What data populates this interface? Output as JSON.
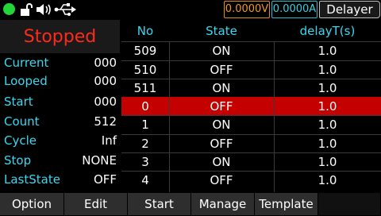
{
  "status_bar": {
    "icons": [
      "power-dot-icon",
      "lock-open-icon",
      "speaker-icon",
      "usb-icon"
    ],
    "voltage": "0.0000V",
    "current": "0.0000A",
    "mode": "Delayer"
  },
  "left_panel": {
    "state": "Stopped",
    "rows": [
      {
        "label": "Current",
        "value": "000"
      },
      {
        "label": "Looped",
        "value": "000"
      },
      {
        "label": "Start",
        "value": "000"
      },
      {
        "label": "Count",
        "value": "512"
      },
      {
        "label": "Cycle",
        "value": "Inf"
      },
      {
        "label": "Stop",
        "value": "NONE"
      },
      {
        "label": "LastState",
        "value": "OFF"
      }
    ]
  },
  "table": {
    "headers": {
      "no": "No",
      "state": "State",
      "delay": "delayT(s)"
    },
    "rows": [
      {
        "no": "509",
        "state": "ON",
        "delay": "1.0"
      },
      {
        "no": "510",
        "state": "OFF",
        "delay": "1.0"
      },
      {
        "no": "511",
        "state": "ON",
        "delay": "1.0"
      },
      {
        "no": "0",
        "state": "OFF",
        "delay": "1.0",
        "selected": true
      },
      {
        "no": "1",
        "state": "ON",
        "delay": "1.0"
      },
      {
        "no": "2",
        "state": "OFF",
        "delay": "1.0"
      },
      {
        "no": "3",
        "state": "ON",
        "delay": "1.0"
      },
      {
        "no": "4",
        "state": "OFF",
        "delay": "1.0"
      }
    ]
  },
  "menu": {
    "buttons": [
      "Option",
      "Edit",
      "Start",
      "Manage",
      "Template",
      ""
    ]
  },
  "colors": {
    "accent_cyan": "#3ad8f0",
    "stopped_red": "#ff2a1a",
    "selection_red": "#c40000",
    "voltage_orange": "#f2991c",
    "power_green": "#22d63a"
  }
}
